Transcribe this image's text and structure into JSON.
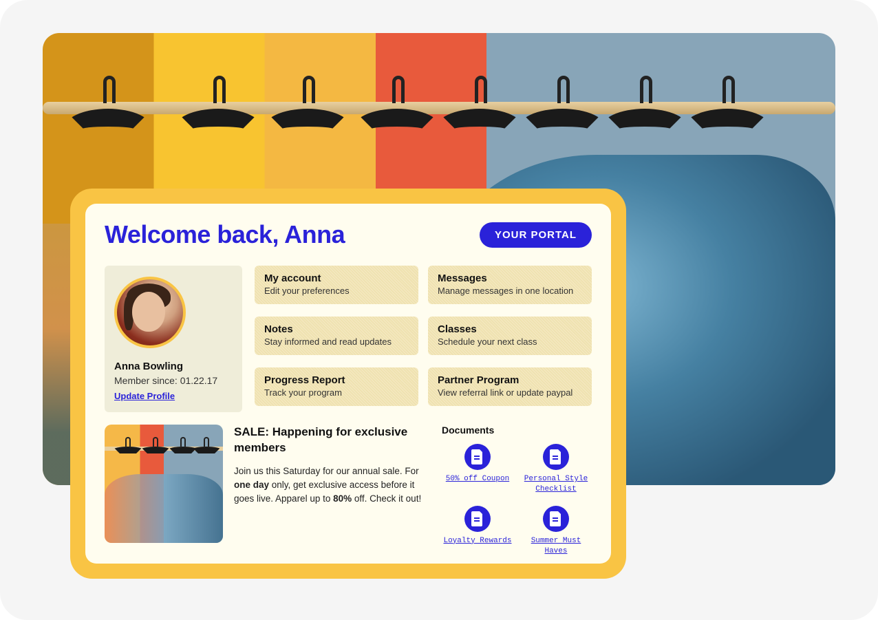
{
  "header": {
    "welcome": "Welcome back, Anna",
    "portal_button": "YOUR PORTAL"
  },
  "profile": {
    "name": "Anna Bowling",
    "member_since_label": "Member since: 01.22.17",
    "update_link": "Update Profile"
  },
  "nav_cards": [
    {
      "title": "My account",
      "sub": "Edit your preferences"
    },
    {
      "title": "Messages",
      "sub": "Manage messages in one location"
    },
    {
      "title": "Notes",
      "sub": "Stay informed and read updates"
    },
    {
      "title": "Classes",
      "sub": "Schedule your next class"
    },
    {
      "title": "Progress Report",
      "sub": "Track your program"
    },
    {
      "title": "Partner Program",
      "sub": "View referral link or update paypal"
    }
  ],
  "promo": {
    "title_prefix": "SALE:",
    "title_rest": " Happening for exclusive members",
    "body_pre": "Join us this Saturday for our annual sale. For ",
    "body_bold1": "one day",
    "body_mid": " only, get exclusive access before it goes live. Apparel up to ",
    "body_bold2": "80%",
    "body_post": " off. Check it out!"
  },
  "documents": {
    "heading": "Documents",
    "items": [
      {
        "label": "50% off Coupon"
      },
      {
        "label": "Personal Style Checklist"
      },
      {
        "label": "Loyalty Rewards"
      },
      {
        "label": "Summer Must Haves"
      }
    ]
  }
}
